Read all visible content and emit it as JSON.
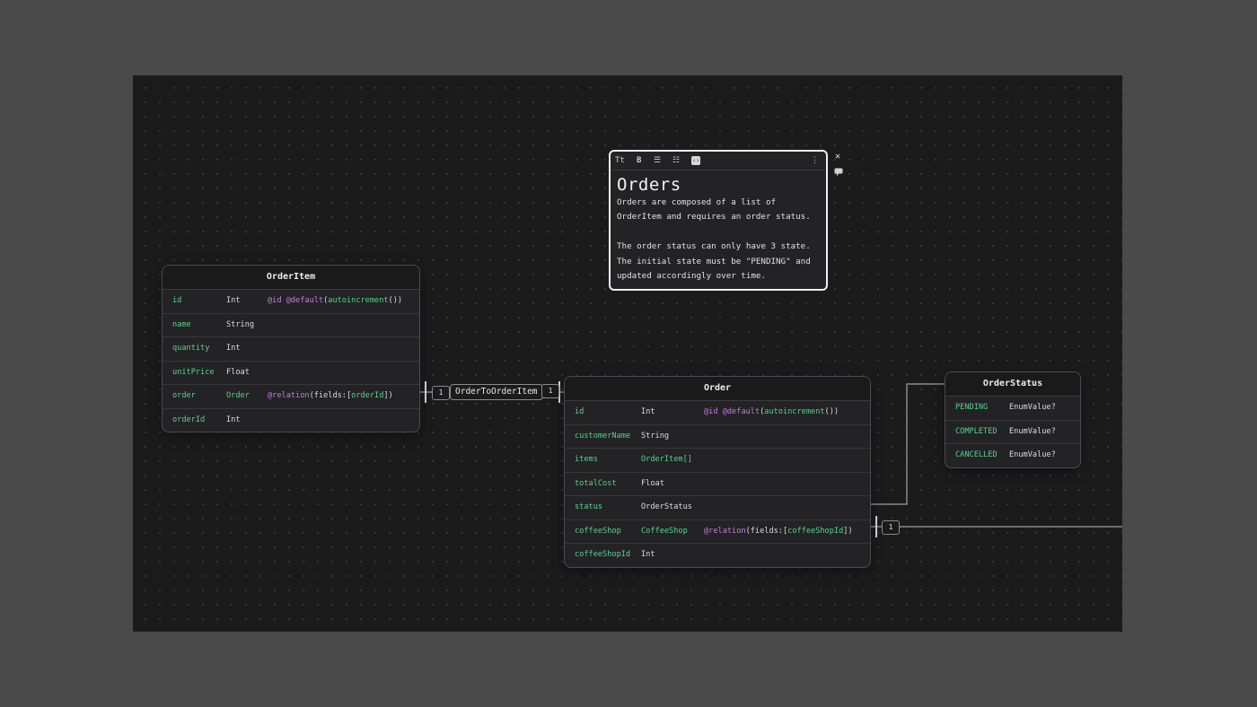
{
  "note": {
    "toolbar": {
      "text_style": "Tt",
      "bold": "B",
      "bullet_list": "☰",
      "numbered_list": "☷",
      "code": "‹›",
      "more": "⋮"
    },
    "title": "Orders",
    "body": "Orders are composed of a list of OrderItem and requires an order status.\n\nThe order status can only have 3 state. The initial state must be \"PENDING\" and updated accordingly over time.",
    "close": "✕",
    "comment_icon": "comment-icon"
  },
  "tables": {
    "order_item": {
      "title": "OrderItem",
      "rows": [
        {
          "name": "id",
          "type": "Int",
          "attr_kw": "@id @default",
          "attr_open": "(",
          "attr_fn": "autoincrement",
          "attr_close": "())"
        },
        {
          "name": "name",
          "type": "String"
        },
        {
          "name": "quantity",
          "type": "Int"
        },
        {
          "name": "unitPrice",
          "type": "Float"
        },
        {
          "name": "order",
          "type": "Order",
          "attr_kw": "@relation",
          "attr_open": "(fields:[",
          "attr_fn": "orderId",
          "attr_close": "])"
        },
        {
          "name": "orderId",
          "type": "Int"
        }
      ]
    },
    "order": {
      "title": "Order",
      "rows": [
        {
          "name": "id",
          "type": "Int",
          "attr_kw": "@id @default",
          "attr_open": "(",
          "attr_fn": "autoincrement",
          "attr_close": "())"
        },
        {
          "name": "customerName",
          "type": "String"
        },
        {
          "name": "items",
          "type": "OrderItem[]"
        },
        {
          "name": "totalCost",
          "type": "Float"
        },
        {
          "name": "status",
          "type": "OrderStatus"
        },
        {
          "name": "coffeeShop",
          "type": "CoffeeShop",
          "attr_kw": "@relation",
          "attr_open": "(fields:[",
          "attr_fn": "coffeeShopId",
          "attr_close": "])"
        },
        {
          "name": "coffeeShopId",
          "type": "Int"
        }
      ]
    },
    "order_status": {
      "title": "OrderStatus",
      "rows": [
        {
          "name": "PENDING",
          "type": "EnumValue?"
        },
        {
          "name": "COMPLETED",
          "type": "EnumValue?"
        },
        {
          "name": "CANCELLED",
          "type": "EnumValue?"
        }
      ]
    }
  },
  "relations": {
    "order_to_order_item": {
      "label": "OrderToOrderItem",
      "left_card": "1",
      "right_card": "1"
    },
    "order_to_coffee_shop": {
      "card": "1"
    }
  },
  "colors": {
    "field_name": "#57d38c",
    "attribute_keyword": "#c77adf",
    "canvas": "#1b1b1c",
    "frame": "#4a4a4a"
  }
}
